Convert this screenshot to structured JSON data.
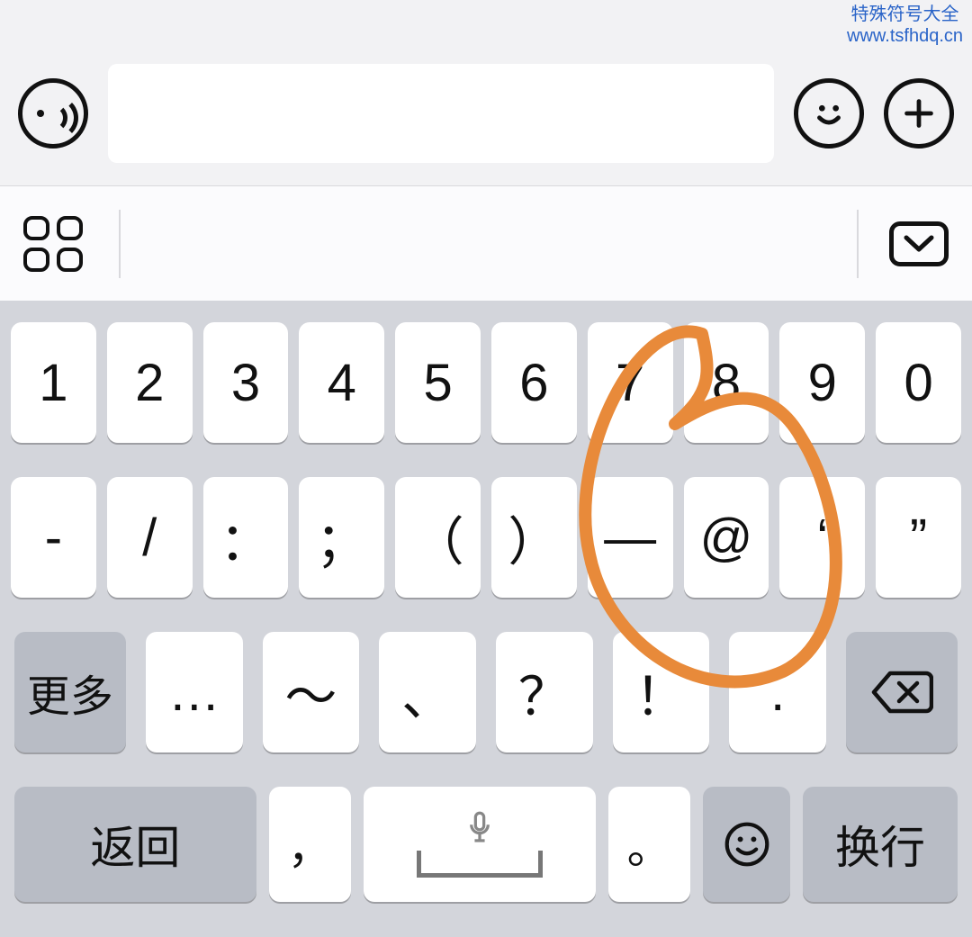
{
  "watermark": {
    "line1": "特殊符号大全",
    "line2": "www.tsfhdq.cn"
  },
  "keyboard": {
    "row1": [
      "1",
      "2",
      "3",
      "4",
      "5",
      "6",
      "7",
      "8",
      "9",
      "0"
    ],
    "row2": [
      "-",
      "/",
      "：",
      "；",
      "（",
      "）",
      "—",
      "@",
      "‘",
      "”"
    ],
    "row3": {
      "more": "更多",
      "k1": "…",
      "k2": "～",
      "k3": "、",
      "k4": "？",
      "k5": "！",
      "k6": "."
    },
    "row4": {
      "return": "返回",
      "comma": "，",
      "period": "。",
      "newline": "换行"
    }
  }
}
